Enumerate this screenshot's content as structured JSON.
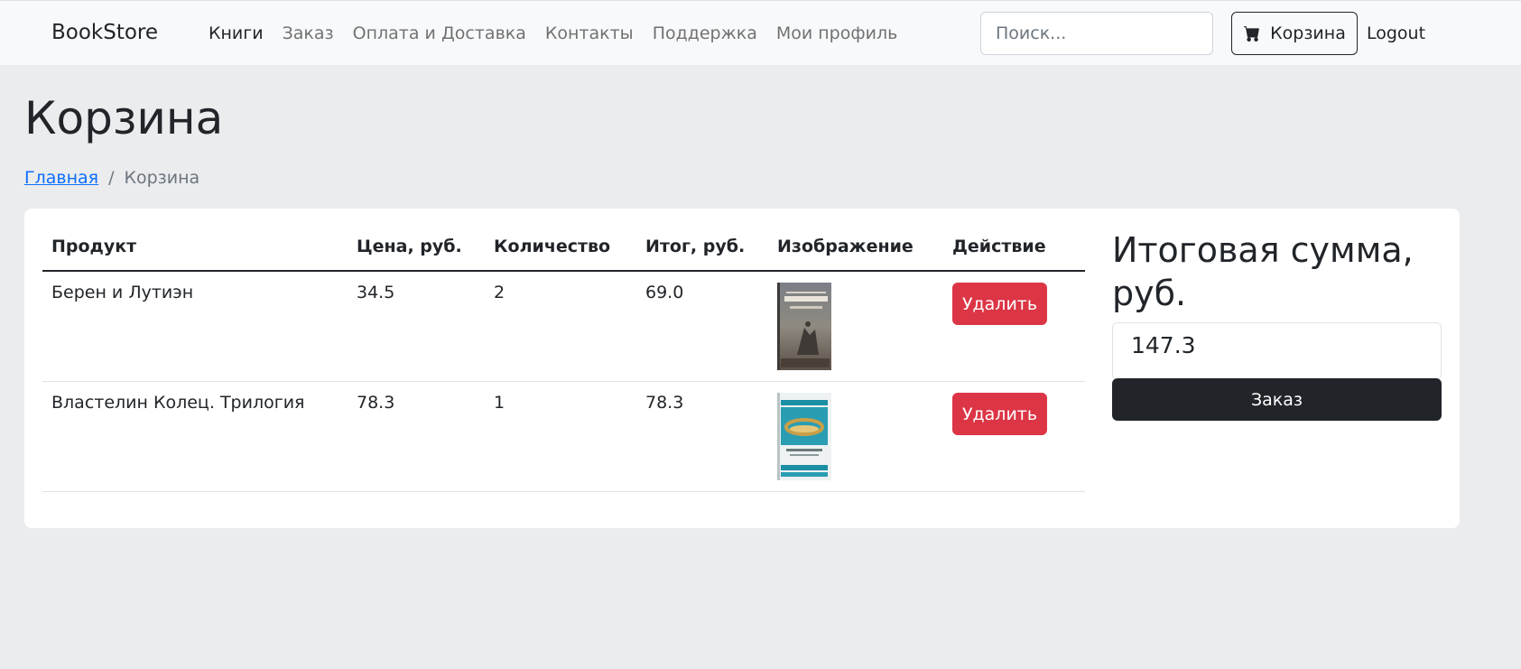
{
  "navbar": {
    "brand": "BookStore",
    "links": [
      {
        "label": "Книги",
        "active": true
      },
      {
        "label": "Заказ",
        "active": false
      },
      {
        "label": "Оплата и Доставка",
        "active": false
      },
      {
        "label": "Контакты",
        "active": false
      },
      {
        "label": "Поддержка",
        "active": false
      },
      {
        "label": "Мои профиль",
        "active": false
      }
    ],
    "search_placeholder": "Поиск...",
    "cart_label": "Корзина",
    "cart_icon": "cart-icon",
    "logout_label": "Logout"
  },
  "page": {
    "title": "Корзина",
    "breadcrumb": {
      "home": "Главная",
      "separator": "/",
      "current": "Корзина"
    }
  },
  "cart": {
    "headers": [
      "Продукт",
      "Цена, руб.",
      "Количество",
      "Итог, руб.",
      "Изображение",
      "Действие"
    ],
    "items": [
      {
        "product": "Берен и Лутиэн",
        "price": "34.5",
        "quantity": "2",
        "total": "69.0",
        "delete_label": "Удалить"
      },
      {
        "product": "Властелин Колец. Трилогия",
        "price": "78.3",
        "quantity": "1",
        "total": "78.3",
        "delete_label": "Удалить"
      }
    ]
  },
  "summary": {
    "title": "Итоговая сумма, руб.",
    "value": "147.3",
    "order_label": "Заказ"
  },
  "colors": {
    "danger": "#dc3545",
    "dark": "#212529",
    "link": "#0d6efd",
    "background": "#ebecee"
  }
}
